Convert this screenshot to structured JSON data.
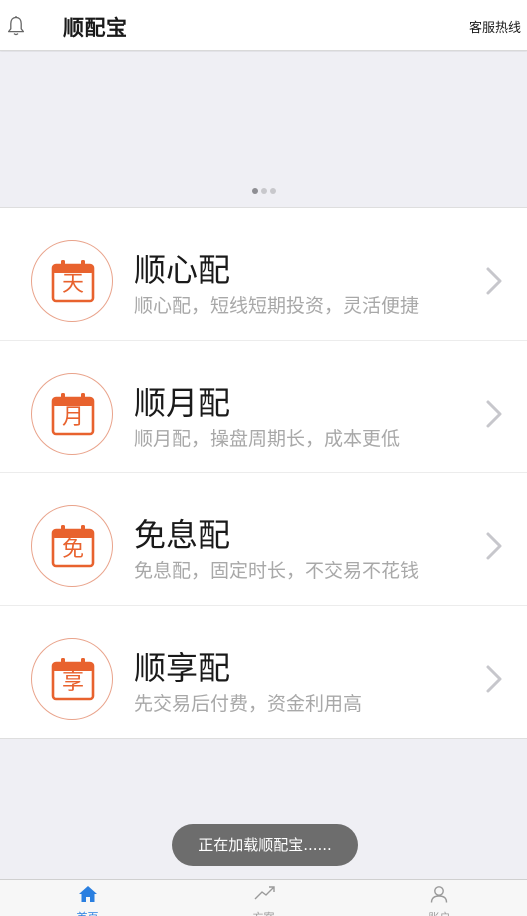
{
  "header": {
    "title": "顺配宝",
    "hotline": "客服热线",
    "bell_icon": "bell-icon"
  },
  "banner": {
    "slides": 3,
    "active_slide": 1
  },
  "products": [
    {
      "icon_char": "天",
      "name": "顺心配",
      "desc": "顺心配，短线短期投资，灵活便捷"
    },
    {
      "icon_char": "月",
      "name": "顺月配",
      "desc": "顺月配，操盘周期长，成本更低"
    },
    {
      "icon_char": "免",
      "name": "免息配",
      "desc": "免息配，固定时长，不交易不花钱"
    },
    {
      "icon_char": "享",
      "name": "顺享配",
      "desc": "先交易后付费，资金利用高"
    }
  ],
  "toast": {
    "text": "正在加载顺配宝......"
  },
  "tabbar": {
    "tabs": [
      {
        "label": "首页",
        "icon": "home-icon",
        "active": true
      },
      {
        "label": "方案",
        "icon": "trend-icon",
        "active": false
      },
      {
        "label": "账户",
        "icon": "user-icon",
        "active": false
      }
    ]
  },
  "colors": {
    "accent": "#e8622e",
    "tab_active": "#2a7fe0",
    "toast_bg": "#6d6d6d"
  }
}
